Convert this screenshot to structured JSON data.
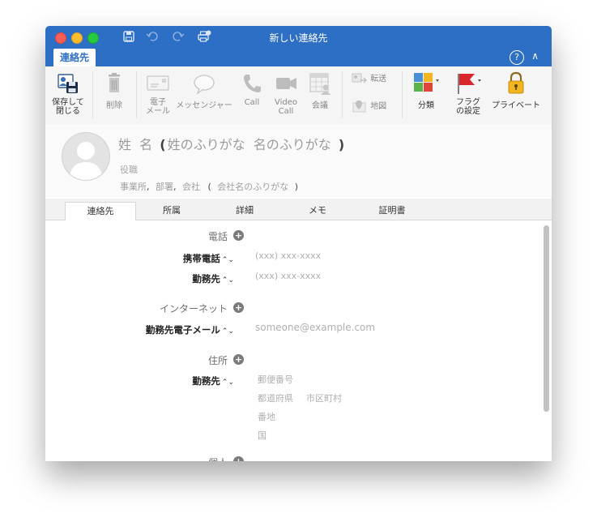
{
  "window": {
    "title": "新しい連絡先",
    "active_tab": "連絡先",
    "help_label": "?"
  },
  "ribbon": {
    "save_close": "保存して\n閉じる",
    "delete": "削除",
    "email": "電子\nメール",
    "messenger": "メッセンジャー",
    "call": "Call",
    "video_call": "Video\nCall",
    "meeting": "会議",
    "forward": "転送",
    "map": "地図",
    "categorize": "分類",
    "flag": "フラグ\nの設定",
    "private": "プライベート"
  },
  "header": {
    "name_placeholder": "姓  名",
    "open_paren": "(",
    "furigana_placeholder": "姓のふりがな  名のふりがな",
    "close_paren": ")",
    "job_title": "役職",
    "office": "事業所",
    "comma": ",",
    "department": "部署",
    "company": "会社",
    "company_furigana": "会社名のふりがな"
  },
  "tabs": [
    "連絡先",
    "所属",
    "詳細",
    "メモ",
    "証明書"
  ],
  "sections": {
    "phone": {
      "title": "電話",
      "fields": [
        {
          "label": "携帯電話",
          "placeholder": "(xxx) xxx-xxxx"
        },
        {
          "label": "勤務先",
          "placeholder": "(xxx) xxx-xxxx"
        }
      ]
    },
    "internet": {
      "title": "インターネット",
      "fields": [
        {
          "label": "勤務先電子メール",
          "placeholder": "someone@example.com"
        }
      ]
    },
    "address": {
      "title": "住所",
      "label": "勤務先",
      "postal": "郵便番号",
      "prefecture": "都道府県",
      "city": "市区町村",
      "street": "番地",
      "country": "国"
    },
    "partial": {
      "title": "個人"
    }
  },
  "colors": {
    "titlebar": "#2e6fc6",
    "flag": "#d9262c",
    "lock": "#f2b51f"
  }
}
